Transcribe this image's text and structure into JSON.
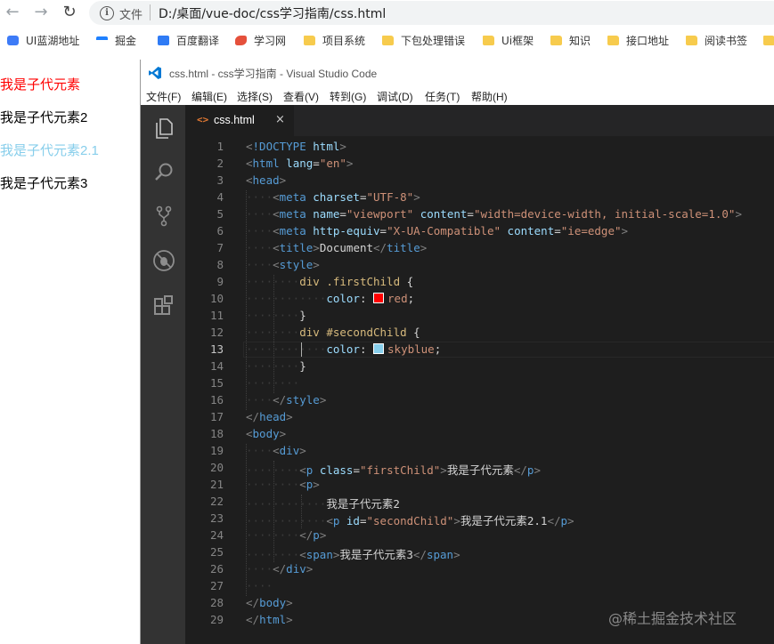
{
  "browser": {
    "address_label": "文件",
    "url": "D:/桌面/vue-doc/css学习指南/css.html"
  },
  "bookmarks": [
    {
      "label": "UI蓝湖地址",
      "icon": "lanhu-icon",
      "color": "#3d7bf7"
    },
    {
      "label": "掘金",
      "icon": "juejin-icon",
      "color": "#1e80ff"
    },
    {
      "label": "百度翻译",
      "icon": "baidu-translate-icon",
      "color": "#2f7bf5"
    },
    {
      "label": "学习网",
      "icon": "fish-icon",
      "color": "#e5503b"
    },
    {
      "label": "项目系统",
      "icon": "folder-icon"
    },
    {
      "label": "下包处理错误",
      "icon": "folder-icon"
    },
    {
      "label": "Ui框架",
      "icon": "folder-icon"
    },
    {
      "label": "知识",
      "icon": "folder-icon"
    },
    {
      "label": "接口地址",
      "icon": "folder-icon"
    },
    {
      "label": "阅读书签",
      "icon": "folder-icon"
    },
    {
      "label": "",
      "icon": "folder-icon"
    }
  ],
  "page": {
    "items": [
      {
        "text": "我是子代元素",
        "color": "#ff0000"
      },
      {
        "text": "我是子代元素2",
        "color": "#000000"
      },
      {
        "text": "我是子代元素2.1",
        "color": "#87ceeb"
      },
      {
        "text": "我是子代元素3",
        "color": "#000000"
      }
    ]
  },
  "vscode": {
    "title": "css.html - css学习指南 - Visual Studio Code",
    "menu": [
      "文件(F)",
      "编辑(E)",
      "选择(S)",
      "查看(V)",
      "转到(G)",
      "调试(D)",
      "任务(T)",
      "帮助(H)"
    ],
    "activity_icons": [
      "explorer-icon",
      "search-icon",
      "source-control-icon",
      "debug-icon",
      "extensions-icon"
    ],
    "tab": {
      "icon": "<>",
      "label": "css.html",
      "close": "×"
    },
    "current_line": 13,
    "lines": [
      {
        "n": "1",
        "tokens": [
          [
            "t-punc",
            "<"
          ],
          [
            "t-dt",
            "!DOCTYPE"
          ],
          [
            "t-txt",
            " "
          ],
          [
            "t-attr",
            "html"
          ],
          [
            "t-punc",
            ">"
          ]
        ]
      },
      {
        "n": "2",
        "tokens": [
          [
            "t-punc",
            "<"
          ],
          [
            "t-tag",
            "html"
          ],
          [
            "t-txt",
            " "
          ],
          [
            "t-attr",
            "lang"
          ],
          [
            "t-txt",
            "="
          ],
          [
            "t-str",
            "\"en\""
          ],
          [
            "t-punc",
            ">"
          ]
        ]
      },
      {
        "n": "3",
        "tokens": [
          [
            "t-punc",
            "<"
          ],
          [
            "t-tag",
            "head"
          ],
          [
            "t-punc",
            ">"
          ]
        ]
      },
      {
        "n": "4",
        "tokens": [
          [
            "ws",
            "····"
          ],
          [
            "t-punc",
            "<"
          ],
          [
            "t-tag",
            "meta"
          ],
          [
            "t-txt",
            " "
          ],
          [
            "t-attr",
            "charset"
          ],
          [
            "t-txt",
            "="
          ],
          [
            "t-str",
            "\"UTF-8\""
          ],
          [
            "t-punc",
            ">"
          ]
        ]
      },
      {
        "n": "5",
        "tokens": [
          [
            "ws",
            "····"
          ],
          [
            "t-punc",
            "<"
          ],
          [
            "t-tag",
            "meta"
          ],
          [
            "t-txt",
            " "
          ],
          [
            "t-attr",
            "name"
          ],
          [
            "t-txt",
            "="
          ],
          [
            "t-str",
            "\"viewport\""
          ],
          [
            "t-txt",
            " "
          ],
          [
            "t-attr",
            "content"
          ],
          [
            "t-txt",
            "="
          ],
          [
            "t-str",
            "\"width=device-width, initial-scale=1.0\""
          ],
          [
            "t-punc",
            ">"
          ]
        ]
      },
      {
        "n": "6",
        "tokens": [
          [
            "ws",
            "····"
          ],
          [
            "t-punc",
            "<"
          ],
          [
            "t-tag",
            "meta"
          ],
          [
            "t-txt",
            " "
          ],
          [
            "t-attr",
            "http-equiv"
          ],
          [
            "t-txt",
            "="
          ],
          [
            "t-str",
            "\"X-UA-Compatible\""
          ],
          [
            "t-txt",
            " "
          ],
          [
            "t-attr",
            "content"
          ],
          [
            "t-txt",
            "="
          ],
          [
            "t-str",
            "\"ie=edge\""
          ],
          [
            "t-punc",
            ">"
          ]
        ]
      },
      {
        "n": "7",
        "tokens": [
          [
            "ws",
            "····"
          ],
          [
            "t-punc",
            "<"
          ],
          [
            "t-tag",
            "title"
          ],
          [
            "t-punc",
            ">"
          ],
          [
            "t-txt",
            "Document"
          ],
          [
            "t-punc",
            "</"
          ],
          [
            "t-tag",
            "title"
          ],
          [
            "t-punc",
            ">"
          ]
        ]
      },
      {
        "n": "8",
        "tokens": [
          [
            "ws",
            "····"
          ],
          [
            "t-punc",
            "<"
          ],
          [
            "t-tag",
            "style"
          ],
          [
            "t-punc",
            ">"
          ]
        ]
      },
      {
        "n": "9",
        "tokens": [
          [
            "ws",
            "········"
          ],
          [
            "t-sel",
            "div .firstChild"
          ],
          [
            "t-txt",
            " {"
          ]
        ]
      },
      {
        "n": "10",
        "tokens": [
          [
            "ws",
            "············"
          ],
          [
            "t-attr",
            "color"
          ],
          [
            "t-txt",
            ": "
          ],
          [
            "swatch",
            "#ff0000"
          ],
          [
            "t-str",
            "red"
          ],
          [
            "t-txt",
            ";"
          ]
        ]
      },
      {
        "n": "11",
        "tokens": [
          [
            "ws",
            "········"
          ],
          [
            "t-txt",
            "}"
          ]
        ]
      },
      {
        "n": "12",
        "tokens": [
          [
            "ws",
            "········"
          ],
          [
            "t-sel",
            "div #secondChild"
          ],
          [
            "t-txt",
            " {"
          ]
        ]
      },
      {
        "n": "13",
        "tokens": [
          [
            "ws",
            "············"
          ],
          [
            "t-attr",
            "color"
          ],
          [
            "t-txt",
            ": "
          ],
          [
            "swatch",
            "#87ceeb"
          ],
          [
            "t-str",
            "skyblue"
          ],
          [
            "t-txt",
            ";"
          ]
        ]
      },
      {
        "n": "14",
        "tokens": [
          [
            "ws",
            "········"
          ],
          [
            "t-txt",
            "}"
          ]
        ]
      },
      {
        "n": "15",
        "tokens": [
          [
            "ws",
            "········"
          ]
        ]
      },
      {
        "n": "16",
        "tokens": [
          [
            "ws",
            "····"
          ],
          [
            "t-punc",
            "</"
          ],
          [
            "t-tag",
            "style"
          ],
          [
            "t-punc",
            ">"
          ]
        ]
      },
      {
        "n": "17",
        "tokens": [
          [
            "t-punc",
            "</"
          ],
          [
            "t-tag",
            "head"
          ],
          [
            "t-punc",
            ">"
          ]
        ]
      },
      {
        "n": "18",
        "tokens": [
          [
            "t-punc",
            "<"
          ],
          [
            "t-tag",
            "body"
          ],
          [
            "t-punc",
            ">"
          ]
        ]
      },
      {
        "n": "19",
        "tokens": [
          [
            "ws",
            "····"
          ],
          [
            "t-punc",
            "<"
          ],
          [
            "t-tag",
            "div"
          ],
          [
            "t-punc",
            ">"
          ]
        ]
      },
      {
        "n": "20",
        "tokens": [
          [
            "ws",
            "········"
          ],
          [
            "t-punc",
            "<"
          ],
          [
            "t-tag",
            "p"
          ],
          [
            "t-txt",
            " "
          ],
          [
            "t-attr",
            "class"
          ],
          [
            "t-txt",
            "="
          ],
          [
            "t-str",
            "\"firstChild\""
          ],
          [
            "t-punc",
            ">"
          ],
          [
            "t-txt",
            "我是子代元素"
          ],
          [
            "t-punc",
            "</"
          ],
          [
            "t-tag",
            "p"
          ],
          [
            "t-punc",
            ">"
          ]
        ]
      },
      {
        "n": "21",
        "tokens": [
          [
            "ws",
            "········"
          ],
          [
            "t-punc",
            "<"
          ],
          [
            "t-tag",
            "p"
          ],
          [
            "t-punc",
            ">"
          ]
        ]
      },
      {
        "n": "22",
        "tokens": [
          [
            "ws",
            "············"
          ],
          [
            "t-txt",
            "我是子代元素2"
          ]
        ]
      },
      {
        "n": "23",
        "tokens": [
          [
            "ws",
            "············"
          ],
          [
            "t-punc",
            "<"
          ],
          [
            "t-tag",
            "p"
          ],
          [
            "t-txt",
            " "
          ],
          [
            "t-attr",
            "id"
          ],
          [
            "t-txt",
            "="
          ],
          [
            "t-str",
            "\"secondChild\""
          ],
          [
            "t-punc",
            ">"
          ],
          [
            "t-txt",
            "我是子代元素2.1"
          ],
          [
            "t-punc",
            "</"
          ],
          [
            "t-tag",
            "p"
          ],
          [
            "t-punc",
            ">"
          ]
        ]
      },
      {
        "n": "24",
        "tokens": [
          [
            "ws",
            "········"
          ],
          [
            "t-punc",
            "</"
          ],
          [
            "t-tag",
            "p"
          ],
          [
            "t-punc",
            ">"
          ]
        ]
      },
      {
        "n": "25",
        "tokens": [
          [
            "ws",
            "········"
          ],
          [
            "t-punc",
            "<"
          ],
          [
            "t-tag",
            "span"
          ],
          [
            "t-punc",
            ">"
          ],
          [
            "t-txt",
            "我是子代元素3"
          ],
          [
            "t-punc",
            "</"
          ],
          [
            "t-tag",
            "span"
          ],
          [
            "t-punc",
            ">"
          ]
        ]
      },
      {
        "n": "26",
        "tokens": [
          [
            "ws",
            "····"
          ],
          [
            "t-punc",
            "</"
          ],
          [
            "t-tag",
            "div"
          ],
          [
            "t-punc",
            ">"
          ]
        ]
      },
      {
        "n": "27",
        "tokens": [
          [
            "ws",
            "····"
          ]
        ]
      },
      {
        "n": "28",
        "tokens": [
          [
            "t-punc",
            "</"
          ],
          [
            "t-tag",
            "body"
          ],
          [
            "t-punc",
            ">"
          ]
        ]
      },
      {
        "n": "29",
        "tokens": [
          [
            "t-punc",
            "</"
          ],
          [
            "t-tag",
            "html"
          ],
          [
            "t-punc",
            ">"
          ]
        ]
      }
    ]
  },
  "watermark": "@稀土掘金技术社区"
}
